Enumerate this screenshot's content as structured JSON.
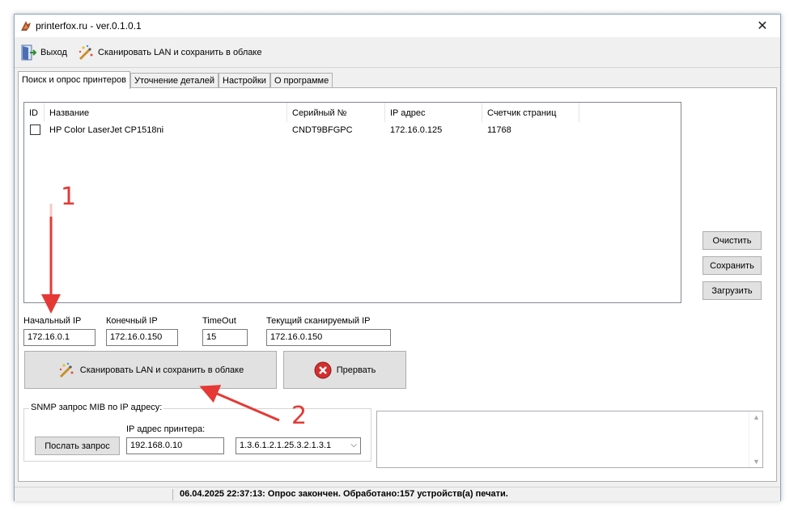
{
  "window": {
    "title": "printerfox.ru - ver.0.1.0.1",
    "close_glyph": "✕"
  },
  "toolbar": {
    "exit_label": "Выход",
    "scan_label": "Сканировать LAN и сохранить в облаке"
  },
  "tabs": [
    {
      "label": "Поиск и опрос принтеров",
      "active": true
    },
    {
      "label": "Уточнение деталей",
      "active": false
    },
    {
      "label": "Настройки",
      "active": false
    },
    {
      "label": "О программе",
      "active": false
    }
  ],
  "printer_list": {
    "columns": [
      "ID",
      "Название",
      "Серийный №",
      "IP адрес",
      "Счетчик страниц"
    ],
    "rows": [
      {
        "checked": false,
        "name": "HP Color LaserJet CP1518ni",
        "serial": "CNDT9BFGPC",
        "ip": "172.16.0.125",
        "pages": "11768"
      }
    ]
  },
  "side_buttons": {
    "clear": "Очистить",
    "save": "Сохранить",
    "load": "Загрузить"
  },
  "scan_range": {
    "start_ip_label": "Начальный IP",
    "start_ip": "172.16.0.1",
    "end_ip_label": "Конечный IP",
    "end_ip": "172.16.0.150",
    "timeout_label": "TimeOut",
    "timeout": "15",
    "current_ip_label": "Текущий сканируемый IP",
    "current_ip": "172.16.0.150"
  },
  "actions": {
    "scan_label": "Сканировать LAN и сохранить в облаке",
    "abort_label": "Прервать"
  },
  "snmp": {
    "legend": "SNMP запрос MIB по IP адресу:",
    "send_label": "Послать запрос",
    "printer_ip_label": "IP адрес принтера:",
    "printer_ip": "192.168.0.10",
    "oid_selected": "1.3.6.1.2.1.25.3.2.1.3.1"
  },
  "status": {
    "text": "06.04.2025 22:37:13: Опрос закончен. Обработано:157 устройств(а) печати."
  },
  "annotations": {
    "one": "1",
    "two": "2",
    "color": "#e53935"
  }
}
